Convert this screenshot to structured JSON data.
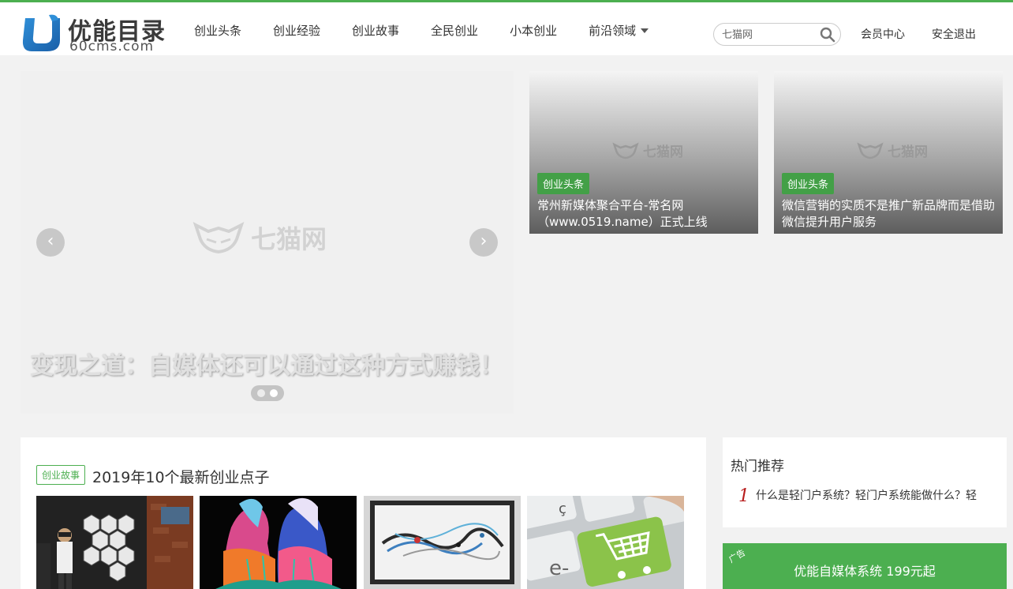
{
  "colors": {
    "accent": "#4caf50",
    "badge": "#43a047",
    "hot_number": "#b71c1c"
  },
  "logo": {
    "title": "优能目录",
    "subtitle": "60cms.com"
  },
  "nav": {
    "items": [
      "创业头条",
      "创业经验",
      "创业故事",
      "全民创业",
      "小本创业",
      "前沿领域"
    ]
  },
  "search": {
    "placeholder": "七猫网",
    "icon": "search-icon"
  },
  "top_links": {
    "member": "会员中心",
    "logout": "安全退出"
  },
  "slider": {
    "watermark": "七猫网",
    "caption": "变现之道：自媒体还可以通过这种方式赚钱！",
    "prev": "‹",
    "next": "›",
    "slides_total": 2,
    "active_slide": 2
  },
  "cards": [
    {
      "badge": "创业头条",
      "title": "常州新媒体聚合平台-常名网（www.0519.name）正式上线",
      "watermark": "七猫网"
    },
    {
      "badge": "创业头条",
      "title": "微信营销的实质不是推广新品牌而是借助微信提升用户服务",
      "watermark": "七猫网"
    }
  ],
  "article": {
    "tag": "创业故事",
    "title": "2019年10个最新创业点子",
    "thumbs": [
      "vr-exhibition-photo",
      "body-paint-art-photo",
      "abstract-painting-photo",
      "ecommerce-keyboard-photo"
    ]
  },
  "hot": {
    "title": "热门推荐",
    "items": [
      {
        "num": "1",
        "text": "什么是轻门户系统？轻门户系统能做什么？轻"
      }
    ]
  },
  "ad": {
    "label": "广告",
    "text": "优能自媒体系统 199元起"
  }
}
